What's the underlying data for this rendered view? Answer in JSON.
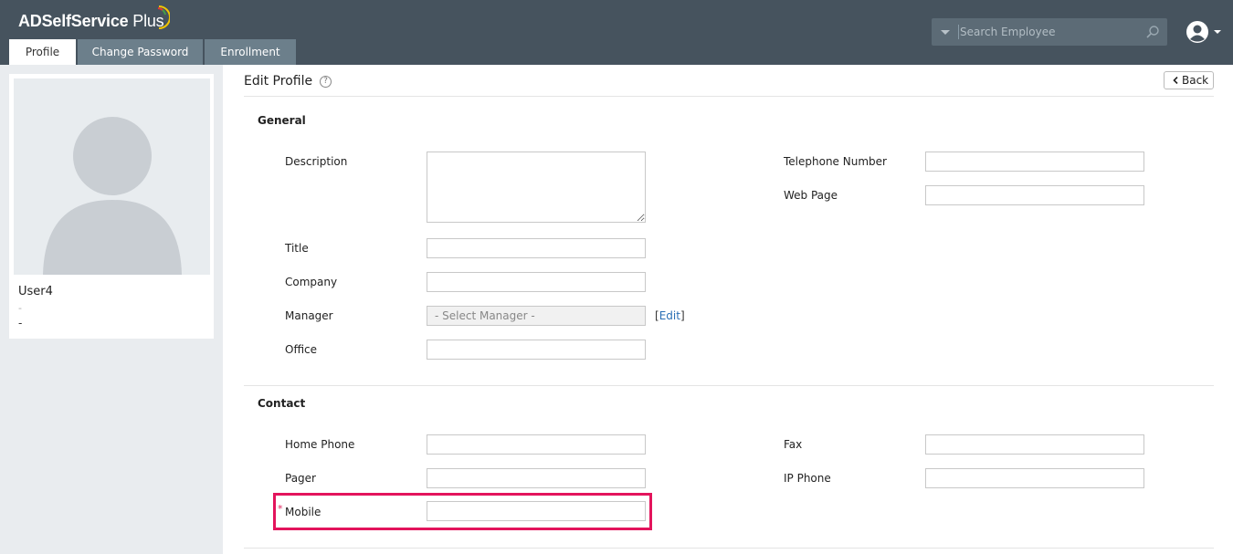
{
  "app": {
    "name_bold": "ADSelfService",
    "name_light": " Plus"
  },
  "tabs": [
    {
      "label": "Profile",
      "active": true
    },
    {
      "label": "Change Password",
      "active": false
    },
    {
      "label": "Enrollment",
      "active": false
    }
  ],
  "search": {
    "placeholder": "Search Employee"
  },
  "user": {
    "name": "User4",
    "line1": "-",
    "line2": "-"
  },
  "page": {
    "title": "Edit Profile",
    "help": "?",
    "back_label": "Back"
  },
  "general": {
    "heading": "General",
    "description_label": "Description",
    "title_label": "Title",
    "company_label": "Company",
    "manager_label": "Manager",
    "manager_placeholder": "- Select Manager -",
    "edit_label": "Edit",
    "office_label": "Office",
    "telephone_label": "Telephone Number",
    "webpage_label": "Web Page"
  },
  "contact": {
    "heading": "Contact",
    "homephone_label": "Home Phone",
    "pager_label": "Pager",
    "mobile_label": "Mobile",
    "required_mark": "*",
    "fax_label": "Fax",
    "ipphone_label": "IP Phone"
  },
  "colors": {
    "header": "#46535e",
    "tab": "#6c7f8b",
    "highlight": "#e3145c",
    "link": "#2a6fb5"
  }
}
